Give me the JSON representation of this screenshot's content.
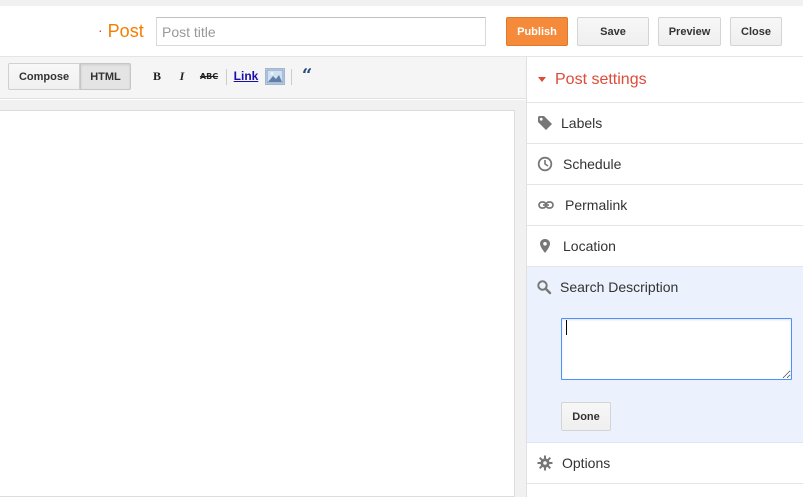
{
  "header": {
    "breadcrumb": "Post",
    "title_placeholder": "Post title",
    "title_value": "",
    "publish_label": "Publish",
    "save_label": "Save",
    "preview_label": "Preview",
    "close_label": "Close"
  },
  "toolbar": {
    "compose_label": "Compose",
    "html_label": "HTML",
    "active_mode": "HTML",
    "bold_label": "B",
    "italic_label": "I",
    "strike_label": "ABC",
    "link_label": "Link",
    "image_icon": "insert-image-icon",
    "quote_label": "“"
  },
  "sidebar": {
    "heading": "Post settings",
    "items": [
      {
        "label": "Labels",
        "icon": "tag-icon"
      },
      {
        "label": "Schedule",
        "icon": "clock-icon"
      },
      {
        "label": "Permalink",
        "icon": "link-icon"
      },
      {
        "label": "Location",
        "icon": "map-pin-icon"
      },
      {
        "label": "Search Description",
        "icon": "search-icon"
      },
      {
        "label": "Options",
        "icon": "gear-icon"
      }
    ],
    "search_description": {
      "value": "",
      "done_label": "Done"
    }
  },
  "colors": {
    "accent": "#dd4b39",
    "publish": "#f48a3a",
    "expanded_bg": "#ebf1fd",
    "focus_border": "#4d90fe"
  }
}
